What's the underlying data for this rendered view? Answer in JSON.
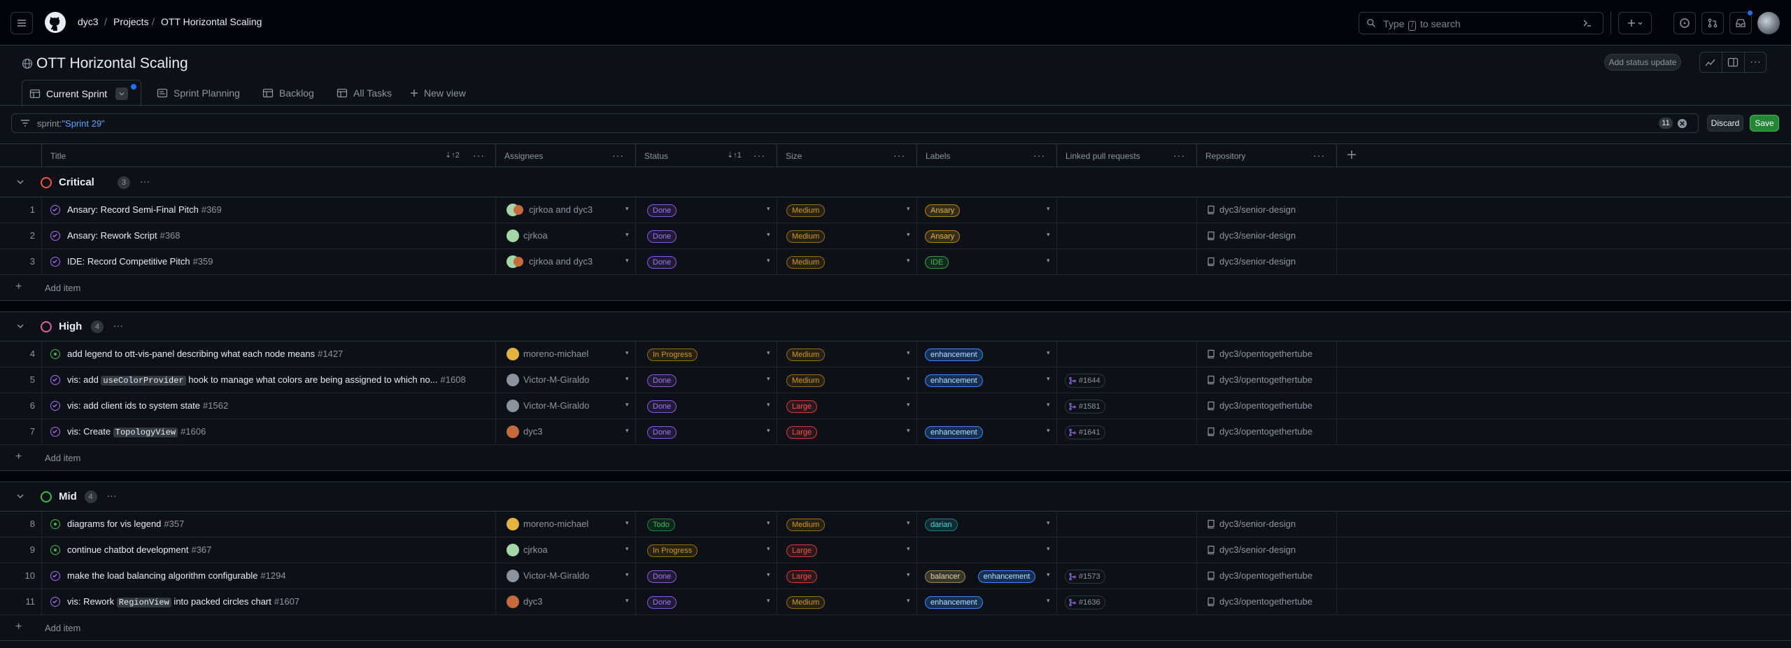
{
  "header": {
    "breadcrumb": [
      "dyc3",
      "Projects",
      "OTT Horizontal Scaling"
    ],
    "search_placeholder_pre": "Type",
    "search_key": "/",
    "search_placeholder_post": "to search"
  },
  "project": {
    "title": "OTT Horizontal Scaling",
    "add_status_update": "Add status update",
    "tabs": [
      "Current Sprint",
      "Sprint Planning",
      "Backlog",
      "All Tasks",
      "New view"
    ]
  },
  "filter": {
    "key": "sprint:",
    "value": "\"Sprint 29\"",
    "count": "11",
    "discard": "Discard",
    "save": "Save"
  },
  "columns": {
    "title": "Title",
    "title_sort": "2",
    "assignees": "Assignees",
    "status": "Status",
    "status_sort": "1",
    "size": "Size",
    "labels": "Labels",
    "linked_prs": "Linked pull requests",
    "repository": "Repository"
  },
  "add_item": "Add item",
  "colors": {
    "critical": "#f85149",
    "high": "#db61a2",
    "mid": "#3fb950",
    "done_icon": "#a371f7",
    "open_icon": "#3fb950"
  },
  "groups": [
    {
      "name": "Critical",
      "count": "3",
      "rows": [
        {
          "num": "1",
          "title": "Ansary: Record Semi-Final Pitch",
          "issue": "#369",
          "assignee": "cjrkoa and dyc3",
          "status": "Done",
          "size": "Medium",
          "labels": [
            "Ansary"
          ],
          "pr": "",
          "repo": "dyc3/senior-design"
        },
        {
          "num": "2",
          "title": "Ansary: Rework Script",
          "issue": "#368",
          "assignee": "cjrkoa",
          "status": "Done",
          "size": "Medium",
          "labels": [
            "Ansary"
          ],
          "pr": "",
          "repo": "dyc3/senior-design"
        },
        {
          "num": "3",
          "title": "IDE: Record Competitive Pitch",
          "issue": "#359",
          "assignee": "cjrkoa and dyc3",
          "status": "Done",
          "size": "Medium",
          "labels": [
            "IDE"
          ],
          "pr": "",
          "repo": "dyc3/senior-design"
        }
      ]
    },
    {
      "name": "High",
      "count": "4",
      "rows": [
        {
          "num": "4",
          "title": "add legend to ott-vis-panel describing what each node means",
          "issue": "#1427",
          "assignee": "moreno-michael",
          "status": "In Progress",
          "size": "Medium",
          "labels": [
            "enhancement"
          ],
          "pr": "",
          "repo": "dyc3/opentogethertube"
        },
        {
          "num": "5",
          "title_parts": [
            "vis: add ",
            "useColorProvider",
            " hook to manage what colors are being assigned to which no..."
          ],
          "issue": "#1608",
          "assignee": "Victor-M-Giraldo",
          "status": "Done",
          "size": "Medium",
          "labels": [
            "enhancement"
          ],
          "pr": "#1644",
          "repo": "dyc3/opentogethertube"
        },
        {
          "num": "6",
          "title": "vis: add client ids to system state",
          "issue": "#1562",
          "assignee": "Victor-M-Giraldo",
          "status": "Done",
          "size": "Large",
          "labels": [],
          "pr": "#1581",
          "repo": "dyc3/opentogethertube"
        },
        {
          "num": "7",
          "title_parts": [
            "vis: Create ",
            "TopologyView",
            ""
          ],
          "issue": "#1606",
          "assignee": "dyc3",
          "status": "Done",
          "size": "Large",
          "labels": [
            "enhancement"
          ],
          "pr": "#1641",
          "repo": "dyc3/opentogethertube"
        }
      ]
    },
    {
      "name": "Mid",
      "count": "4",
      "rows": [
        {
          "num": "8",
          "title": "diagrams for vis legend",
          "issue": "#357",
          "assignee": "moreno-michael",
          "status": "Todo",
          "size": "Medium",
          "labels": [
            "darian"
          ],
          "pr": "",
          "repo": "dyc3/senior-design"
        },
        {
          "num": "9",
          "title": "continue chatbot development",
          "issue": "#367",
          "assignee": "cjrkoa",
          "status": "In Progress",
          "size": "Large",
          "labels": [],
          "pr": "",
          "repo": "dyc3/senior-design"
        },
        {
          "num": "10",
          "title": "make the load balancing algorithm configurable",
          "issue": "#1294",
          "assignee": "Victor-M-Giraldo",
          "status": "Done",
          "size": "Large",
          "labels": [
            "balancer",
            "enhancement"
          ],
          "pr": "#1573",
          "repo": "dyc3/opentogethertube"
        },
        {
          "num": "11",
          "title_parts": [
            "vis: Rework ",
            "RegionView",
            " into packed circles chart"
          ],
          "issue": "#1607",
          "assignee": "dyc3",
          "status": "Done",
          "size": "Medium",
          "labels": [
            "enhancement"
          ],
          "pr": "#1636",
          "repo": "dyc3/opentogethertube"
        }
      ]
    }
  ]
}
